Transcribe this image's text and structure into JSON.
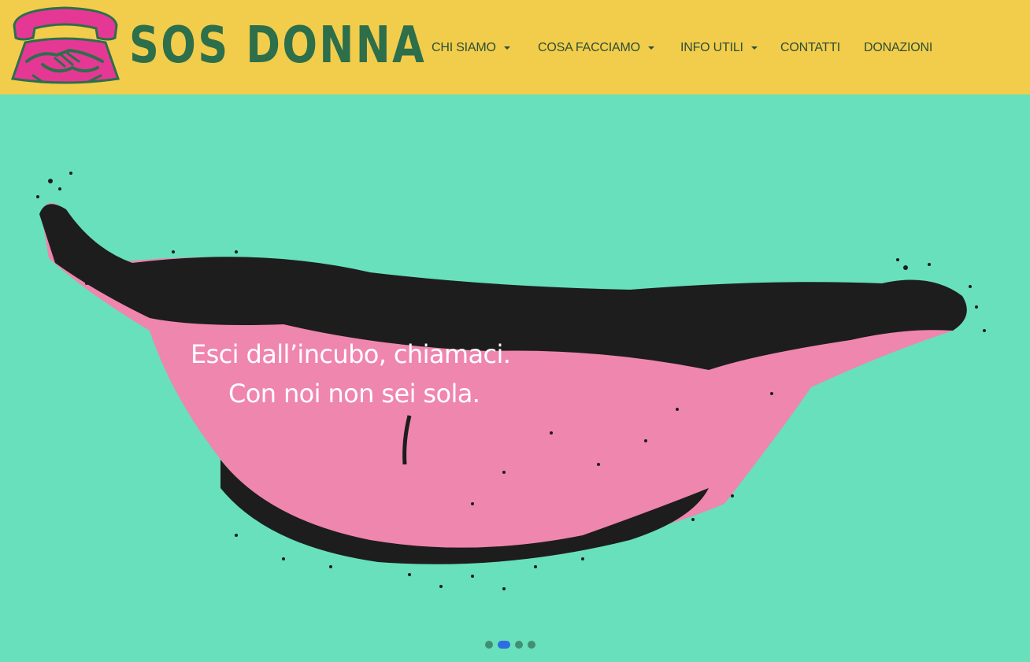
{
  "header": {
    "logo_text": "SOS DONNA",
    "colors": {
      "background": "#f2cc4b",
      "logo_text": "#2d6e4b",
      "nav_text": "#2b4f37",
      "logo_icon": "#e53895"
    }
  },
  "nav": {
    "items": [
      {
        "label": "CHI SIAMO",
        "dropdown": true
      },
      {
        "label": "COSA FACCIAMO",
        "dropdown": true
      },
      {
        "label": "INFO UTILI",
        "dropdown": true
      },
      {
        "label": "CONTATTI",
        "dropdown": false
      },
      {
        "label": "DONAZIONI",
        "dropdown": false
      }
    ]
  },
  "hero": {
    "caption_line1": "Esci dall’incubo, chiamaci.",
    "caption_line2": "Con noi non sei sola.",
    "colors": {
      "background": "#67e0bb",
      "lips": "#ef86ad",
      "ink": "#1d1d1d"
    }
  },
  "carousel": {
    "slide_count": 4,
    "active_slide": 2
  }
}
